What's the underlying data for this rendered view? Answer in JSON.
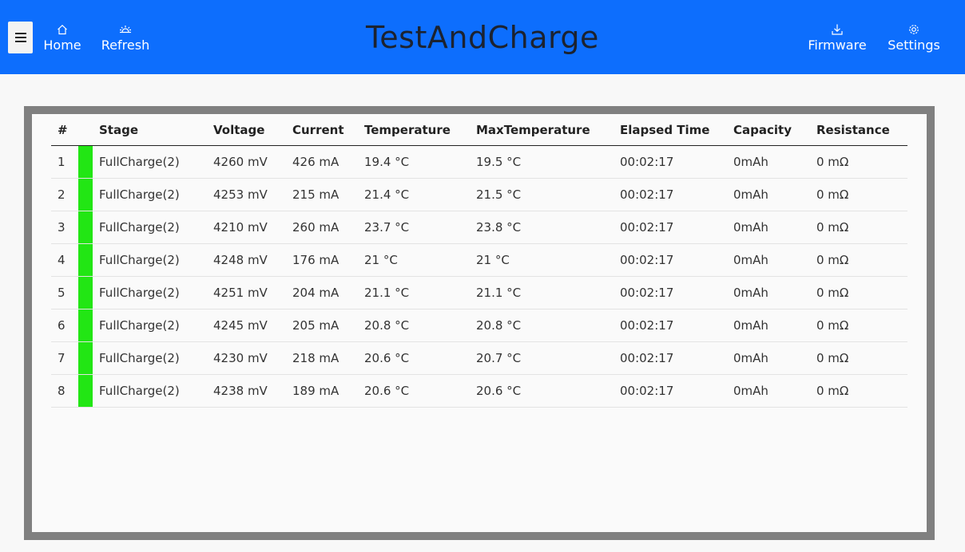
{
  "header": {
    "title": "TestAndCharge",
    "menu_icon": "hamburger-icon",
    "nav_left": [
      {
        "label": "Home",
        "icon": "home-icon"
      },
      {
        "label": "Refresh",
        "icon": "refresh-icon"
      }
    ],
    "nav_right": [
      {
        "label": "Firmware",
        "icon": "download-icon"
      },
      {
        "label": "Settings",
        "icon": "gear-icon"
      }
    ]
  },
  "colors": {
    "header_bg": "#0d6efd",
    "status_ok": "#22e614",
    "frame": "#808080"
  },
  "table": {
    "columns": [
      "#",
      "Stage",
      "Voltage",
      "Current",
      "Temperature",
      "MaxTemperature",
      "Elapsed Time",
      "Capacity",
      "Resistance"
    ],
    "rows": [
      {
        "num": "1",
        "stage": "FullCharge(2)",
        "voltage": "4260 mV",
        "current": "426 mA",
        "temperature": "19.4 °C",
        "max_temperature": "19.5 °C",
        "elapsed": "00:02:17",
        "capacity": "0mAh",
        "resistance": "0 mΩ"
      },
      {
        "num": "2",
        "stage": "FullCharge(2)",
        "voltage": "4253 mV",
        "current": "215 mA",
        "temperature": "21.4 °C",
        "max_temperature": "21.5 °C",
        "elapsed": "00:02:17",
        "capacity": "0mAh",
        "resistance": "0 mΩ"
      },
      {
        "num": "3",
        "stage": "FullCharge(2)",
        "voltage": "4210 mV",
        "current": "260 mA",
        "temperature": "23.7 °C",
        "max_temperature": "23.8 °C",
        "elapsed": "00:02:17",
        "capacity": "0mAh",
        "resistance": "0 mΩ"
      },
      {
        "num": "4",
        "stage": "FullCharge(2)",
        "voltage": "4248 mV",
        "current": "176 mA",
        "temperature": "21 °C",
        "max_temperature": "21 °C",
        "elapsed": "00:02:17",
        "capacity": "0mAh",
        "resistance": "0 mΩ"
      },
      {
        "num": "5",
        "stage": "FullCharge(2)",
        "voltage": "4251 mV",
        "current": "204 mA",
        "temperature": "21.1 °C",
        "max_temperature": "21.1 °C",
        "elapsed": "00:02:17",
        "capacity": "0mAh",
        "resistance": "0 mΩ"
      },
      {
        "num": "6",
        "stage": "FullCharge(2)",
        "voltage": "4245 mV",
        "current": "205 mA",
        "temperature": "20.8 °C",
        "max_temperature": "20.8 °C",
        "elapsed": "00:02:17",
        "capacity": "0mAh",
        "resistance": "0 mΩ"
      },
      {
        "num": "7",
        "stage": "FullCharge(2)",
        "voltage": "4230 mV",
        "current": "218 mA",
        "temperature": "20.6 °C",
        "max_temperature": "20.7 °C",
        "elapsed": "00:02:17",
        "capacity": "0mAh",
        "resistance": "0 mΩ"
      },
      {
        "num": "8",
        "stage": "FullCharge(2)",
        "voltage": "4238 mV",
        "current": "189 mA",
        "temperature": "20.6 °C",
        "max_temperature": "20.6 °C",
        "elapsed": "00:02:17",
        "capacity": "0mAh",
        "resistance": "0 mΩ"
      }
    ]
  }
}
